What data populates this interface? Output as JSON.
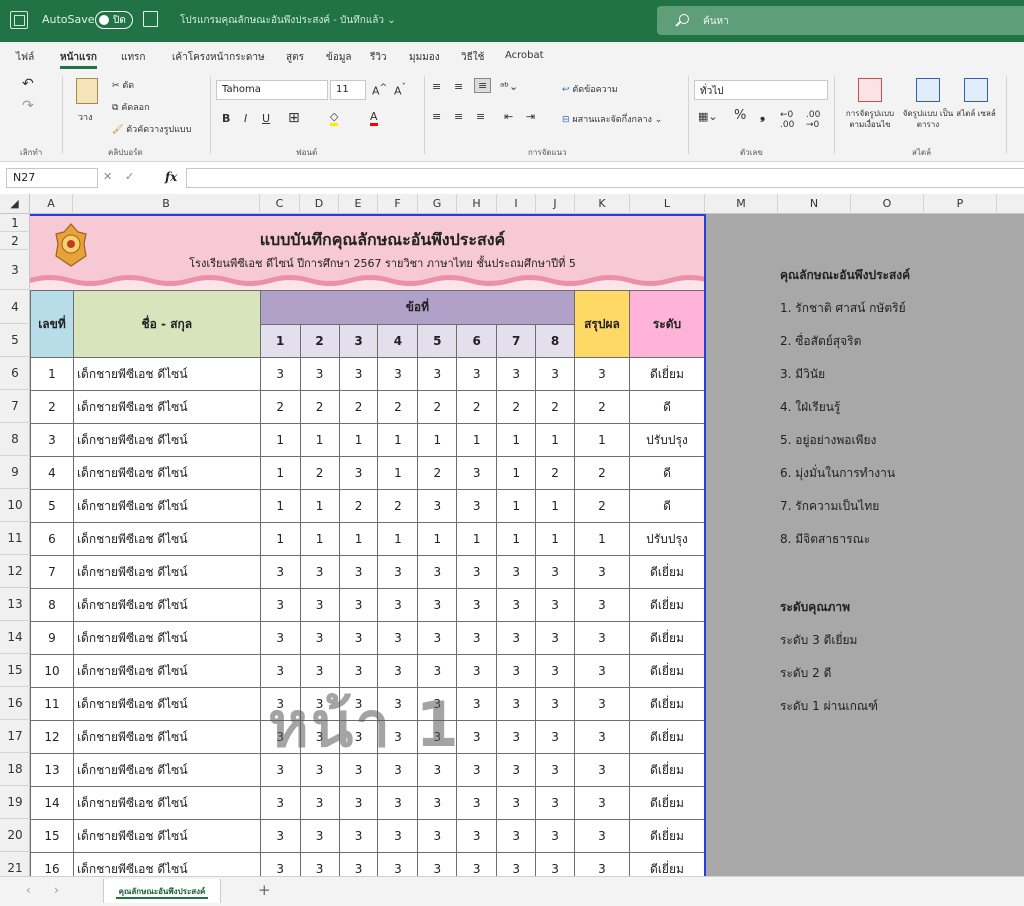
{
  "titlebar": {
    "autosave": "AutoSave",
    "toggle_state": "ปิด",
    "doc_title": "โปรแกรมคุณลักษณะอันพึงประสงค์ - บันทึกแล้ว ⌄",
    "search_placeholder": "ค้นหา"
  },
  "ribbon_tabs": [
    "ไฟล์",
    "หน้าแรก",
    "แทรก",
    "เค้าโครงหน้ากระดาษ",
    "สูตร",
    "ข้อมูล",
    "รีวิว",
    "มุมมอง",
    "วิธีใช้",
    "Acrobat"
  ],
  "ribbon": {
    "undo_label": "เลิกทำ",
    "paste_label": "วาง",
    "cut_label": "ตัด",
    "copy_label": "คัดลอก",
    "format_painter_label": "ตัวคัดวางรูปแบบ",
    "clipboard_label": "คลิปบอร์ด",
    "font_name": "Tahoma",
    "font_size": "11",
    "font_label": "ฟอนต์",
    "wrap_text": "ตัดข้อความ",
    "merge_center": "ผสานและจัดกึ่งกลาง",
    "alignment_label": "การจัดแนว",
    "number_format": "ทั่วไป",
    "number_label": "ตัวเลข",
    "cond_format": "การจัดรูปแบบ ตามเงื่อนไข",
    "format_table": "จัดรูปแบบ เป็นตาราง",
    "cell_styles": "สไตล์ เซลล์",
    "styles_label": "สไตล์"
  },
  "formula_bar": {
    "name_box": "N27",
    "fx": "fx",
    "value": ""
  },
  "columns": [
    "A",
    "B",
    "C",
    "D",
    "E",
    "F",
    "G",
    "H",
    "I",
    "J",
    "K",
    "L",
    "M",
    "N",
    "O",
    "P"
  ],
  "rows": [
    "1",
    "2",
    "3",
    "4",
    "5",
    "6",
    "7",
    "8",
    "9",
    "10",
    "11",
    "12",
    "13",
    "14",
    "15",
    "16",
    "17",
    "18",
    "19",
    "20",
    "21"
  ],
  "sheet": {
    "title": "แบบบันทึกคุณลักษณะอันพึงประสงค์",
    "subtitle": "โรงเรียนพีซีเอช ดีไซน์ ปีการศึกษา 2567 รายวิชา ภาษาไทย ชั้นประถมศึกษาปีที่ 5",
    "header_no": "เลขที่",
    "header_name": "ชื่อ - สกุล",
    "header_items": "ข้อที่",
    "item_numbers": [
      "1",
      "2",
      "3",
      "4",
      "5",
      "6",
      "7",
      "8"
    ],
    "header_summary": "สรุปผล",
    "header_level": "ระดับ",
    "students": [
      {
        "no": "1",
        "name": "เด็กชายพีซีเอช ดีไซน์",
        "scores": [
          "3",
          "3",
          "3",
          "3",
          "3",
          "3",
          "3",
          "3"
        ],
        "summary": "3",
        "level": "ดีเยี่ยม"
      },
      {
        "no": "2",
        "name": "เด็กชายพีซีเอช ดีไซน์",
        "scores": [
          "2",
          "2",
          "2",
          "2",
          "2",
          "2",
          "2",
          "2"
        ],
        "summary": "2",
        "level": "ดี"
      },
      {
        "no": "3",
        "name": "เด็กชายพีซีเอช ดีไซน์",
        "scores": [
          "1",
          "1",
          "1",
          "1",
          "1",
          "1",
          "1",
          "1"
        ],
        "summary": "1",
        "level": "ปรับปรุง"
      },
      {
        "no": "4",
        "name": "เด็กชายพีซีเอช ดีไซน์",
        "scores": [
          "1",
          "2",
          "3",
          "1",
          "2",
          "3",
          "1",
          "2"
        ],
        "summary": "2",
        "level": "ดี"
      },
      {
        "no": "5",
        "name": "เด็กชายพีซีเอช ดีไซน์",
        "scores": [
          "1",
          "1",
          "2",
          "2",
          "3",
          "3",
          "1",
          "1"
        ],
        "summary": "2",
        "level": "ดี"
      },
      {
        "no": "6",
        "name": "เด็กชายพีซีเอช ดีไซน์",
        "scores": [
          "1",
          "1",
          "1",
          "1",
          "1",
          "1",
          "1",
          "1"
        ],
        "summary": "1",
        "level": "ปรับปรุง"
      },
      {
        "no": "7",
        "name": "เด็กชายพีซีเอช ดีไซน์",
        "scores": [
          "3",
          "3",
          "3",
          "3",
          "3",
          "3",
          "3",
          "3"
        ],
        "summary": "3",
        "level": "ดีเยี่ยม"
      },
      {
        "no": "8",
        "name": "เด็กชายพีซีเอช ดีไซน์",
        "scores": [
          "3",
          "3",
          "3",
          "3",
          "3",
          "3",
          "3",
          "3"
        ],
        "summary": "3",
        "level": "ดีเยี่ยม"
      },
      {
        "no": "9",
        "name": "เด็กชายพีซีเอช ดีไซน์",
        "scores": [
          "3",
          "3",
          "3",
          "3",
          "3",
          "3",
          "3",
          "3"
        ],
        "summary": "3",
        "level": "ดีเยี่ยม"
      },
      {
        "no": "10",
        "name": "เด็กชายพีซีเอช ดีไซน์",
        "scores": [
          "3",
          "3",
          "3",
          "3",
          "3",
          "3",
          "3",
          "3"
        ],
        "summary": "3",
        "level": "ดีเยี่ยม"
      },
      {
        "no": "11",
        "name": "เด็กชายพีซีเอช ดีไซน์",
        "scores": [
          "3",
          "3",
          "3",
          "3",
          "3",
          "3",
          "3",
          "3"
        ],
        "summary": "3",
        "level": "ดีเยี่ยม"
      },
      {
        "no": "12",
        "name": "เด็กชายพีซีเอช ดีไซน์",
        "scores": [
          "3",
          "3",
          "3",
          "3",
          "3",
          "3",
          "3",
          "3"
        ],
        "summary": "3",
        "level": "ดีเยี่ยม"
      },
      {
        "no": "13",
        "name": "เด็กชายพีซีเอช ดีไซน์",
        "scores": [
          "3",
          "3",
          "3",
          "3",
          "3",
          "3",
          "3",
          "3"
        ],
        "summary": "3",
        "level": "ดีเยี่ยม"
      },
      {
        "no": "14",
        "name": "เด็กชายพีซีเอช ดีไซน์",
        "scores": [
          "3",
          "3",
          "3",
          "3",
          "3",
          "3",
          "3",
          "3"
        ],
        "summary": "3",
        "level": "ดีเยี่ยม"
      },
      {
        "no": "15",
        "name": "เด็กชายพีซีเอช ดีไซน์",
        "scores": [
          "3",
          "3",
          "3",
          "3",
          "3",
          "3",
          "3",
          "3"
        ],
        "summary": "3",
        "level": "ดีเยี่ยม"
      },
      {
        "no": "16",
        "name": "เด็กชายพีซีเอช ดีไซน์",
        "scores": [
          "3",
          "3",
          "3",
          "3",
          "3",
          "3",
          "3",
          "3"
        ],
        "summary": "3",
        "level": "ดีเยี่ยม"
      }
    ],
    "watermark": "หน้า 1"
  },
  "notes": {
    "traits_title": "คุณลักษณะอันพึงประสงค์",
    "traits": [
      "1. รักชาติ ศาสน์ กษัตริย์",
      "2. ซื่อสัตย์สุจริต",
      "3. มีวินัย",
      "4. ใฝ่เรียนรู้",
      "5. อยู่อย่างพอเพียง",
      "6. มุ่งมั่นในการทำงาน",
      "7. รักความเป็นไทย",
      "8. มีจิตสาธารณะ"
    ],
    "levels_title": "ระดับคุณภาพ",
    "levels": [
      "ระดับ 3  ดีเยี่ยม",
      "ระดับ 2  ดี",
      "ระดับ 1 ผ่านเกณฑ์"
    ]
  },
  "sheet_tabs": {
    "active": "คุณลักษณะอันพึงประสงค์",
    "add": "+"
  },
  "colors": {
    "excel_green": "#217346",
    "banner_pink": "#f6c9d5",
    "header_blue": "#b6dde8",
    "header_green": "#d8e4bc",
    "header_purple": "#b1a0c7",
    "header_yellow": "#ffd966",
    "header_pink": "#ffb3d9",
    "page_break_blue": "#2540d8"
  }
}
